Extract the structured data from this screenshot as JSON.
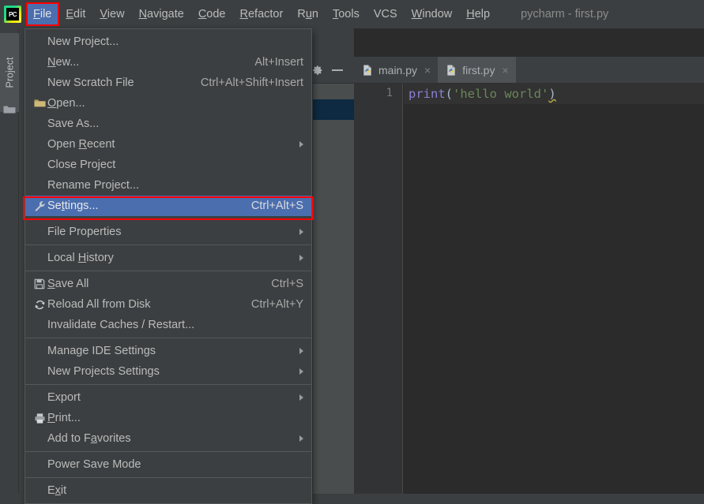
{
  "window": {
    "title": "pycharm - first.py",
    "logo_text": "PC"
  },
  "menubar": {
    "items": [
      {
        "label": "File",
        "mnemonic": "F",
        "active": true
      },
      {
        "label": "Edit",
        "mnemonic": "E",
        "active": false
      },
      {
        "label": "View",
        "mnemonic": "V",
        "active": false
      },
      {
        "label": "Navigate",
        "mnemonic": "N",
        "active": false
      },
      {
        "label": "Code",
        "mnemonic": "C",
        "active": false
      },
      {
        "label": "Refactor",
        "mnemonic": "R",
        "active": false
      },
      {
        "label": "Run",
        "mnemonic": "u",
        "active": false
      },
      {
        "label": "Tools",
        "mnemonic": "T",
        "active": false
      },
      {
        "label": "VCS",
        "mnemonic": "",
        "active": false
      },
      {
        "label": "Window",
        "mnemonic": "W",
        "active": false
      },
      {
        "label": "Help",
        "mnemonic": "H",
        "active": false
      }
    ]
  },
  "file_menu": {
    "groups": [
      {
        "items": [
          {
            "label": "New Project...",
            "mnemonic": "",
            "accel": "",
            "icon": "",
            "submenu": false,
            "highlighted": false
          },
          {
            "label": "New...",
            "mnemonic": "N",
            "accel": "Alt+Insert",
            "icon": "",
            "submenu": false,
            "highlighted": false
          },
          {
            "label": "New Scratch File",
            "mnemonic": "",
            "accel": "Ctrl+Alt+Shift+Insert",
            "icon": "",
            "submenu": false,
            "highlighted": false
          },
          {
            "label": "Open...",
            "mnemonic": "O",
            "accel": "",
            "icon": "folder-icon",
            "submenu": false,
            "highlighted": false
          },
          {
            "label": "Save As...",
            "mnemonic": "",
            "accel": "",
            "icon": "",
            "submenu": false,
            "highlighted": false
          },
          {
            "label": "Open Recent",
            "mnemonic": "R",
            "accel": "",
            "icon": "",
            "submenu": true,
            "highlighted": false
          },
          {
            "label": "Close Project",
            "mnemonic": "",
            "accel": "",
            "icon": "",
            "submenu": false,
            "highlighted": false
          },
          {
            "label": "Rename Project...",
            "mnemonic": "",
            "accel": "",
            "icon": "",
            "submenu": false,
            "highlighted": false
          },
          {
            "label": "Settings...",
            "mnemonic": "t",
            "accel": "Ctrl+Alt+S",
            "icon": "wrench-icon",
            "submenu": false,
            "highlighted": true
          }
        ]
      },
      {
        "items": [
          {
            "label": "File Properties",
            "mnemonic": "",
            "accel": "",
            "icon": "",
            "submenu": true,
            "highlighted": false
          }
        ]
      },
      {
        "items": [
          {
            "label": "Local History",
            "mnemonic": "H",
            "accel": "",
            "icon": "",
            "submenu": true,
            "highlighted": false
          }
        ]
      },
      {
        "items": [
          {
            "label": "Save All",
            "mnemonic": "S",
            "accel": "Ctrl+S",
            "icon": "save-icon",
            "submenu": false,
            "highlighted": false
          },
          {
            "label": "Reload All from Disk",
            "mnemonic": "",
            "accel": "Ctrl+Alt+Y",
            "icon": "reload-icon",
            "submenu": false,
            "highlighted": false
          },
          {
            "label": "Invalidate Caches / Restart...",
            "mnemonic": "",
            "accel": "",
            "icon": "",
            "submenu": false,
            "highlighted": false
          }
        ]
      },
      {
        "items": [
          {
            "label": "Manage IDE Settings",
            "mnemonic": "",
            "accel": "",
            "icon": "",
            "submenu": true,
            "highlighted": false
          },
          {
            "label": "New Projects Settings",
            "mnemonic": "",
            "accel": "",
            "icon": "",
            "submenu": true,
            "highlighted": false
          }
        ]
      },
      {
        "items": [
          {
            "label": "Export",
            "mnemonic": "",
            "accel": "",
            "icon": "",
            "submenu": true,
            "highlighted": false
          },
          {
            "label": "Print...",
            "mnemonic": "P",
            "accel": "",
            "icon": "print-icon",
            "submenu": false,
            "highlighted": false
          },
          {
            "label": "Add to Favorites",
            "mnemonic": "a",
            "accel": "",
            "icon": "",
            "submenu": true,
            "highlighted": false
          }
        ]
      },
      {
        "items": [
          {
            "label": "Power Save Mode",
            "mnemonic": "",
            "accel": "",
            "icon": "",
            "submenu": false,
            "highlighted": false
          }
        ]
      },
      {
        "items": [
          {
            "label": "Exit",
            "mnemonic": "x",
            "accel": "",
            "icon": "",
            "submenu": false,
            "highlighted": false
          }
        ]
      }
    ]
  },
  "tool_window": {
    "project_tab_label": "Project",
    "folder_icon": "folder-icon",
    "gear_icon": "gear-icon",
    "minimize_icon": "minimize-icon"
  },
  "editor": {
    "tabs": [
      {
        "label": "main.py",
        "icon": "python-file-icon",
        "selected": false,
        "close": "×"
      },
      {
        "label": "first.py",
        "icon": "python-file-icon",
        "selected": true,
        "close": "×"
      }
    ],
    "line_numbers": [
      "1"
    ],
    "code": {
      "fn": "print",
      "open_paren": "(",
      "string": "'hello world'",
      "close_paren": ")"
    }
  },
  "annotations": {
    "highlight_color": "#ff0000",
    "selection_color": "#4b6eaf"
  }
}
